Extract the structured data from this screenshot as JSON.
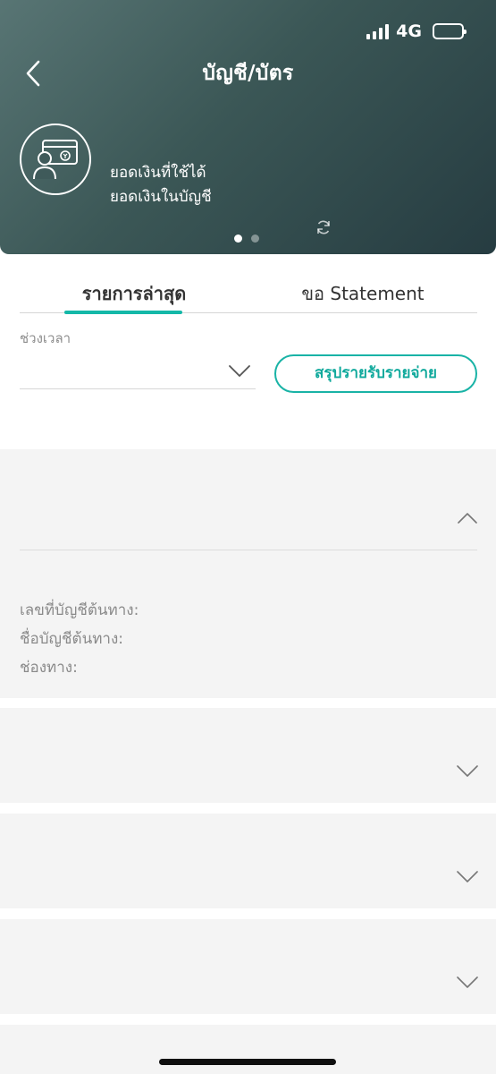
{
  "status_bar": {
    "network": "4G",
    "icons": [
      "signal-icon",
      "battery-icon"
    ]
  },
  "header": {
    "title": "บัญชี/บัตร",
    "back_icon": "chevron-left-icon",
    "account_icon": "account-card-icon",
    "available_balance_label": "ยอดเงินที่ใช้ได้",
    "account_balance_label": "ยอดเงินในบัญชี",
    "refresh_icon": "refresh-icon",
    "page_dots": {
      "count": 2,
      "active_index": 0
    }
  },
  "tabs": [
    {
      "label": "รายการล่าสุด",
      "active": true
    },
    {
      "label": "ขอ Statement",
      "active": false
    }
  ],
  "filter": {
    "period_label": "ช่วงเวลา",
    "period_value": "",
    "summary_button": "สรุปรายรับรายจ่าย"
  },
  "transactions": {
    "expanded": {
      "source_account_no_label": "เลขที่บัญชีต้นทาง:",
      "source_account_name_label": "ชื่อบัญชีต้นทาง:",
      "channel_label": "ช่องทาง:"
    },
    "collapsed_count": 3
  },
  "colors": {
    "accent": "#14b8a8",
    "header_start": "#587574",
    "header_end": "#263c41",
    "card_bg": "#f4f4f4"
  }
}
